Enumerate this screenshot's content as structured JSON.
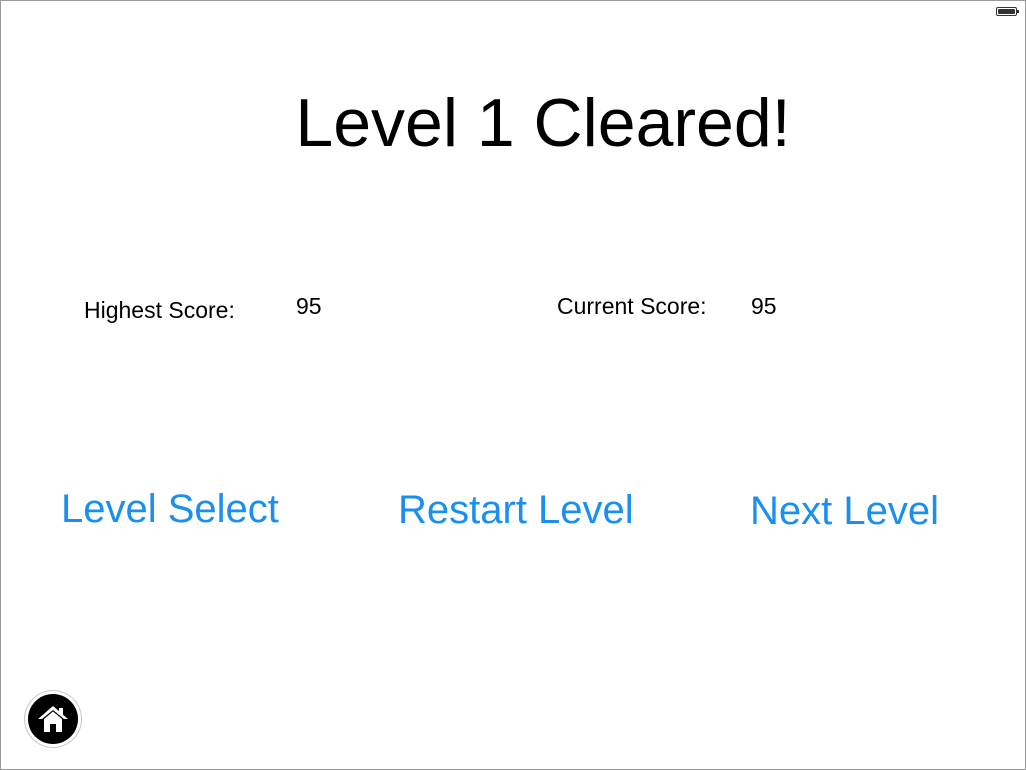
{
  "status_bar": {
    "battery_icon": "battery-icon"
  },
  "header": {
    "title": "Level 1 Cleared!"
  },
  "scores": {
    "highest_label": "Highest Score:",
    "highest_value": "95",
    "current_label": "Current Score:",
    "current_value": "95"
  },
  "actions": {
    "level_select_label": "Level Select",
    "restart_label": "Restart Level",
    "next_label": "Next Level",
    "color": "#1a8ff0"
  },
  "footer": {
    "home_icon": "home-icon"
  }
}
